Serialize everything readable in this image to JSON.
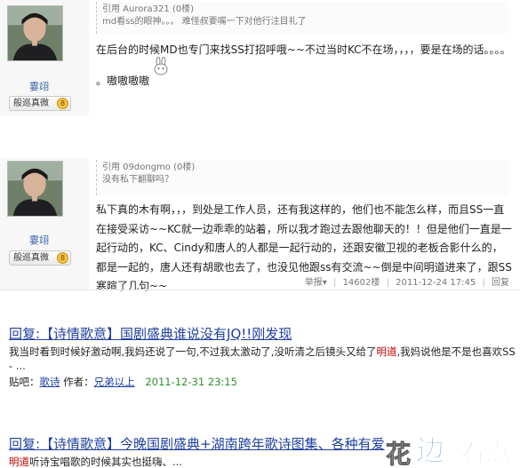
{
  "post1": {
    "username": "霎翊",
    "rank_badge": "般巡真微",
    "rank_level": "8",
    "quote_header": "引用 Aurora321 (0楼)",
    "quote_body": "md看ss的眼神。。。 难怪叔要嘴一下对他行注目礼了",
    "content_line1": "在后台的时候MD也专门来找SS打招呼哦~~不过当时KC不在场，，，，要是在场的话。。。。",
    "content_line2": "。嗷嗷嗷嗷"
  },
  "post2": {
    "username": "霎翊",
    "rank_badge": "般巡真微",
    "rank_level": "8",
    "quote_header": "引用 09dongmo (0楼)",
    "quote_body": "没有私下翻聊吗？",
    "content": "私下真的木有啊，，，到处是工作人员，还有我这样的，他们也不能怎么样，而且SS一直在接受采访~~KC就一边乖乖的站着，所以我才跑过去跟他聊天的！！但是他们一直是一起行动的，KC、Cindy和唐人的人都是一起行动的，还跟安徽卫视的老板合影什么的，都是一起的，唐人还有胡歌也去了，也没见他跟ss有交流~~倒是中间明道进来了，跟SS寒暄了几句~~",
    "report": "举报",
    "views": "14602楼",
    "datetime": "2011-12-24 17:45",
    "reply": "回复"
  },
  "result1": {
    "title": "回复:【诗情歌意】国剧盛典谁说没有JQ!!刚发现",
    "snippet_before": "我当时看到时候好激动啊,我妈还说了一句,不过我太激动了,没听清之后镜头又给了",
    "snippet_highlight": "明道",
    "snippet_after": ",我妈说他是不是也喜欢SS - ...",
    "info_prefix": "贴吧：",
    "forum": "歌诗",
    "author_label": "作者：",
    "author": "兄弟以上",
    "date": "2011-12-31 23:15"
  },
  "result2": {
    "title": "回复:【诗情歌意】今晚国剧盛典+湖南跨年歌诗图集、各种有爱",
    "snippet_highlight": "明道",
    "snippet_after": "听诗宝唱歌的时候其实也挺嗨、..."
  },
  "watermark": {
    "a": "花",
    "b": "边",
    "c": "看点"
  },
  "colors": {
    "link": "#1f3f9f",
    "highlight": "#c00000",
    "date_green": "#2f8f2f"
  }
}
